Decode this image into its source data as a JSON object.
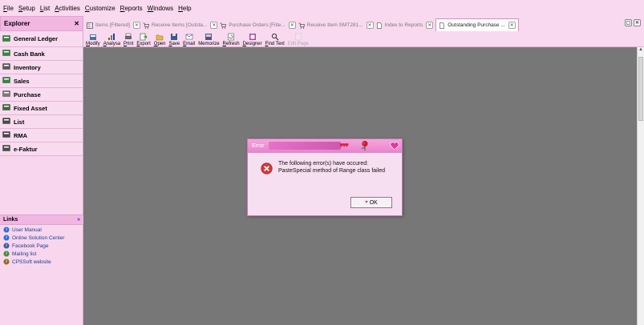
{
  "menubar": {
    "items": [
      {
        "u": "F",
        "rest": "ile"
      },
      {
        "u": "S",
        "rest": "etup"
      },
      {
        "u": "L",
        "rest": "ist"
      },
      {
        "u": "A",
        "rest": "ctivities"
      },
      {
        "u": "C",
        "rest": "ustomize"
      },
      {
        "u": "R",
        "rest": "eports"
      },
      {
        "u": "W",
        "rest": "indows"
      },
      {
        "u": "H",
        "rest": "elp"
      }
    ]
  },
  "explorer": {
    "title": "Explorer",
    "close": "✕"
  },
  "tabs": [
    {
      "label": "Items [Filtered]",
      "icon": "table-icon",
      "active": false
    },
    {
      "label": "Receive Items [Outsta...",
      "icon": "cart-icon",
      "active": false
    },
    {
      "label": "Purchase Orders [Filte...",
      "icon": "cart-icon",
      "active": false
    },
    {
      "label": "Receive Item SMT281...",
      "icon": "cart-icon",
      "active": false
    },
    {
      "label": "Index to Reports",
      "icon": "doc-icon",
      "active": false
    },
    {
      "label": "Outstanding Purchase ...",
      "icon": "doc-icon",
      "active": true
    }
  ],
  "toolbar": [
    {
      "u": "M",
      "rest": "odify",
      "icon": "modify-icon",
      "enabled": true
    },
    {
      "u": "A",
      "rest": "nalysa",
      "icon": "analysis-icon",
      "enabled": true
    },
    {
      "u": "P",
      "rest": "rint",
      "icon": "print-icon",
      "enabled": true
    },
    {
      "u": "E",
      "rest": "xport",
      "icon": "export-icon",
      "enabled": true
    },
    {
      "u": "O",
      "rest": "pen",
      "icon": "open-icon",
      "enabled": true
    },
    {
      "u": "S",
      "rest": "ave",
      "icon": "save-icon",
      "enabled": true
    },
    {
      "u": "E",
      "rest": "mail",
      "icon": "email-icon",
      "enabled": true
    },
    {
      "u": "",
      "rest": "Memorize",
      "icon": "memorize-icon",
      "enabled": true
    },
    {
      "u": "R",
      "rest": "efresh",
      "icon": "refresh-icon",
      "enabled": true
    },
    {
      "u": "D",
      "rest": "esigner",
      "icon": "designer-icon",
      "enabled": true
    },
    {
      "u": "F",
      "rest": "ind Text",
      "icon": "find-icon",
      "enabled": true
    },
    {
      "u": "",
      "rest": "Edit Page",
      "icon": "edit-page-icon",
      "enabled": false
    }
  ],
  "sidebar": {
    "items": [
      {
        "label": "General Ledger",
        "icon": "ledger-icon",
        "color": "#2e8b3a"
      },
      {
        "label": "Cash Bank",
        "icon": "cash-icon",
        "color": "#2e8b3a"
      },
      {
        "label": "Inventory",
        "icon": "inventory-icon",
        "color": "#5a5a5a"
      },
      {
        "label": "Sales",
        "icon": "sales-icon",
        "color": "#2e8b3a"
      },
      {
        "label": "Purchase",
        "icon": "purchase-icon",
        "color": "#7a7a7a"
      },
      {
        "label": "Fixed Asset",
        "icon": "asset-icon",
        "color": "#3a6a3a"
      },
      {
        "label": "List",
        "icon": "list-icon",
        "color": "#4a4a4a"
      },
      {
        "label": "RMA",
        "icon": "rma-icon",
        "color": "#4a4a4a"
      },
      {
        "label": "e-Faktur",
        "icon": "efaktur-icon",
        "color": "#4a4a4a"
      }
    ]
  },
  "links": {
    "title": "Links",
    "collapse": "»",
    "items": [
      {
        "label": "User Manual",
        "icon": "help-icon"
      },
      {
        "label": "Online Solution Center",
        "icon": "help-icon"
      },
      {
        "label": "Facebook Page",
        "icon": "facebook-icon"
      },
      {
        "label": "Mailing list",
        "icon": "mailing-icon"
      },
      {
        "label": "CPSSoft website",
        "icon": "web-icon"
      }
    ]
  },
  "dialog": {
    "title": "Error",
    "line1": "The following error(s) have occured:",
    "line2": "PasteSpecial method of Range class failed",
    "ok_label": "OK"
  },
  "colors": {
    "main_bg": "#777777",
    "pink": "#f7d6ee",
    "title": "#e883cd"
  }
}
